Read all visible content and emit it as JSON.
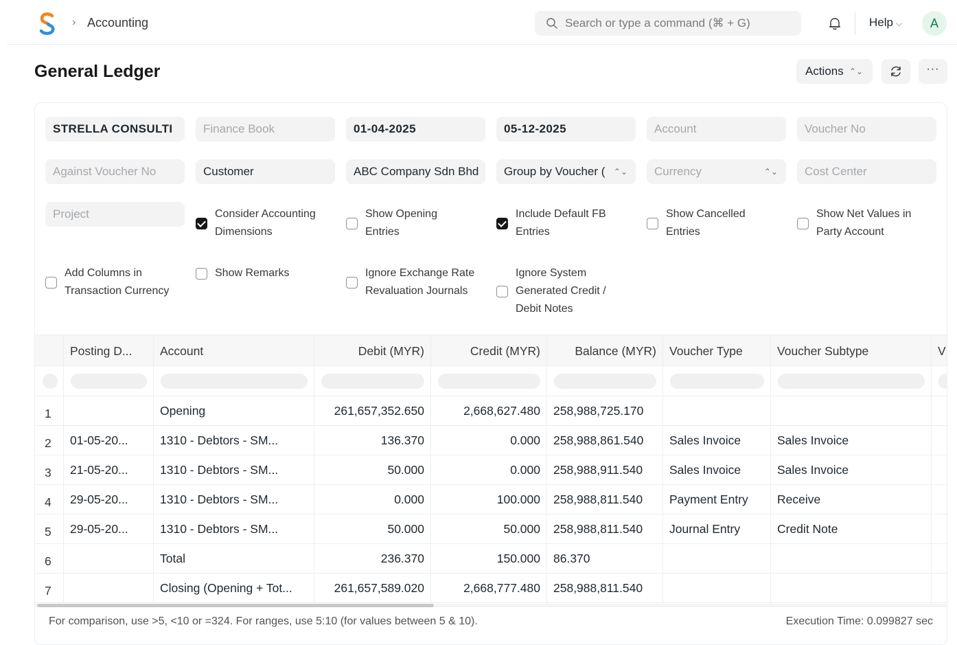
{
  "navbar": {
    "breadcrumb": "Accounting",
    "search_placeholder": "Search or type a command (⌘ + G)",
    "help_label": "Help",
    "avatar_initial": "A"
  },
  "page": {
    "title": "General Ledger",
    "actions_label": "Actions"
  },
  "filters": {
    "company": "STRELLA CONSULTI",
    "finance_book": "Finance Book",
    "from_date": "01-04-2025",
    "to_date": "05-12-2025",
    "account": "Account",
    "voucher_no": "Voucher No",
    "against_voucher_no": "Against Voucher No",
    "party_type": "Customer",
    "party": "ABC Company Sdn Bhd",
    "group_by": "Group by Voucher (",
    "currency": "Currency",
    "cost_center": "Cost Center",
    "project": "Project"
  },
  "checkboxes": [
    {
      "label": "Consider Accounting\nDimensions",
      "checked": true
    },
    {
      "label": "Show Opening\nEntries",
      "checked": false
    },
    {
      "label": "Include Default FB\nEntries",
      "checked": true
    },
    {
      "label": "Show Cancelled\nEntries",
      "checked": false
    },
    {
      "label": "Show Net Values in\nParty Account",
      "checked": false
    },
    {
      "label": "Add Columns in\nTransaction Currency",
      "checked": false
    },
    {
      "label": "Show Remarks",
      "checked": false
    },
    {
      "label": "Ignore Exchange Rate\nRevaluation Journals",
      "checked": false
    },
    {
      "label": "Ignore System\nGenerated Credit /\nDebit Notes",
      "checked": false
    }
  ],
  "table": {
    "columns": [
      "Posting D...",
      "Account",
      "Debit (MYR)",
      "Credit (MYR)",
      "Balance (MYR)",
      "Voucher Type",
      "Voucher Subtype",
      "V"
    ],
    "rows": [
      {
        "idx": "1",
        "posting_date": "",
        "account": "Opening",
        "debit": "261,657,352.650",
        "credit": "2,668,627.480",
        "balance": "258,988,725.170",
        "voucher_type": "",
        "voucher_subtype": ""
      },
      {
        "idx": "2",
        "posting_date": "01-05-20...",
        "account": "1310 - Debtors - SM...",
        "debit": "136.370",
        "credit": "0.000",
        "balance": "258,988,861.540",
        "voucher_type": "Sales Invoice",
        "voucher_subtype": "Sales Invoice"
      },
      {
        "idx": "3",
        "posting_date": "21-05-20...",
        "account": "1310 - Debtors - SM...",
        "debit": "50.000",
        "credit": "0.000",
        "balance": "258,988,911.540",
        "voucher_type": "Sales Invoice",
        "voucher_subtype": "Sales Invoice"
      },
      {
        "idx": "4",
        "posting_date": "29-05-20...",
        "account": "1310 - Debtors - SM...",
        "debit": "0.000",
        "credit": "100.000",
        "balance": "258,988,811.540",
        "voucher_type": "Payment Entry",
        "voucher_subtype": "Receive"
      },
      {
        "idx": "5",
        "posting_date": "29-05-20...",
        "account": "1310 - Debtors - SM...",
        "debit": "50.000",
        "credit": "50.000",
        "balance": "258,988,811.540",
        "voucher_type": "Journal Entry",
        "voucher_subtype": "Credit Note"
      },
      {
        "idx": "6",
        "posting_date": "",
        "account": "Total",
        "debit": "236.370",
        "credit": "150.000",
        "balance": "86.370",
        "voucher_type": "",
        "voucher_subtype": ""
      },
      {
        "idx": "7",
        "posting_date": "",
        "account": "Closing (Opening + Tot...",
        "debit": "261,657,589.020",
        "credit": "2,668,777.480",
        "balance": "258,988,811.540",
        "voucher_type": "",
        "voucher_subtype": ""
      }
    ]
  },
  "footer": {
    "hint": "For comparison, use >5, <10 or =324. For ranges, use 5:10 (for values between 5 & 10).",
    "execution_time": "Execution Time: 0.099827 sec"
  },
  "colors": {
    "logo_orange": "#f5841f",
    "logo_blue": "#2f8fd8",
    "avatar_bg": "#e4f5e9",
    "avatar_text": "#16794c",
    "checkbox_on": "#171717"
  }
}
